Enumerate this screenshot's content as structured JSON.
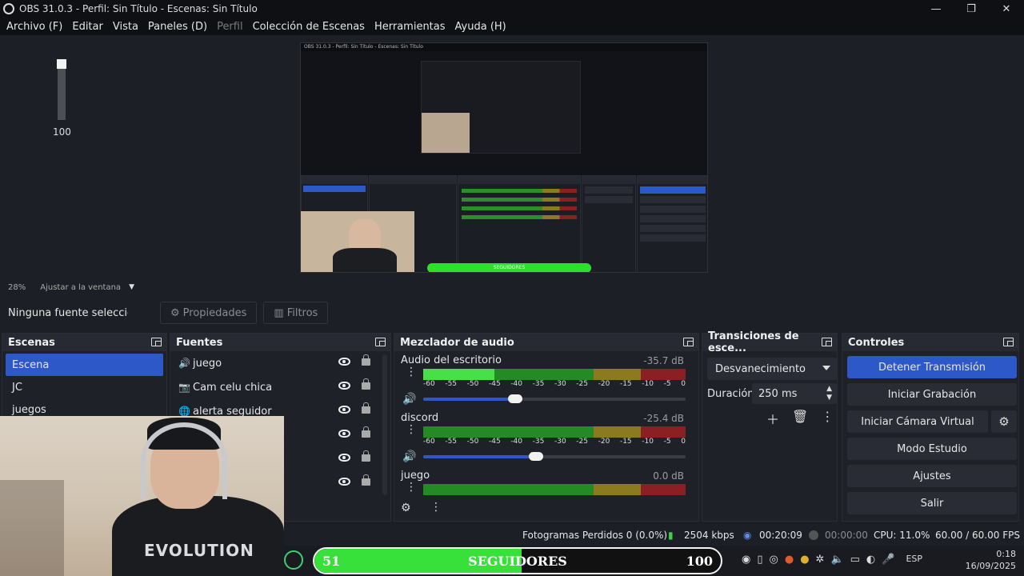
{
  "window": {
    "title": "OBS 31.0.3 - Perfil: Sin Título - Escenas: Sin Título"
  },
  "menu": [
    "Archivo (F)",
    "Editar",
    "Vista",
    "Paneles (D)",
    "Perfil",
    "Colección de Escenas",
    "Herramientas",
    "Ayuda (H)"
  ],
  "preview": {
    "volume_value": "100",
    "nested_title": "OBS 31.0.3 - Perfil: Sin Título - Escenas: Sin Título",
    "nested_follow_label": "SEGUIDORES",
    "zoom": "28%",
    "fit_label": "Ajustar a la ventana"
  },
  "source_toolbar": {
    "no_selection": "Ninguna fuente seleccionada",
    "properties": "Propiedades",
    "filters": "Filtros"
  },
  "scenes": {
    "title": "Escenas",
    "items": [
      "Escena",
      "JC",
      "juegos"
    ],
    "selected": "Escena"
  },
  "sources": {
    "title": "Fuentes",
    "items": [
      {
        "name": "juego",
        "icon": "speaker-icon"
      },
      {
        "name": "Cam celu chica",
        "icon": "camera-icon"
      },
      {
        "name": "alerta seguidor",
        "icon": "browser-icon"
      }
    ]
  },
  "mixer": {
    "title": "Mezclador de audio",
    "ticks": [
      "-60",
      "-55",
      "-50",
      "-45",
      "-40",
      "-35",
      "-30",
      "-25",
      "-20",
      "-15",
      "-10",
      "-5",
      "0"
    ],
    "channels": [
      {
        "name": "Audio del escritorio",
        "db": "-35.7 dB",
        "level": 0.27,
        "volume": 0.35
      },
      {
        "name": "discord",
        "db": "-25.4 dB",
        "level": 0,
        "volume": 0.43
      },
      {
        "name": "juego",
        "db": "0.0 dB",
        "level": 0,
        "volume": 0
      }
    ]
  },
  "transitions": {
    "title": "Transiciones de escena",
    "title_shown": "Transiciones de esce...",
    "current": "Desvanecimiento",
    "duration_label": "Duración",
    "duration": "250 ms"
  },
  "controls": {
    "title": "Controles",
    "buttons": [
      "Detener Transmisión",
      "Iniciar Grabación",
      "Iniciar Cámara Virtual",
      "Modo Estudio",
      "Ajustes",
      "Salir"
    ]
  },
  "status": {
    "dropped": "Fotogramas Perdidos 0 (0.0%)",
    "bitrate": "2504 kbps",
    "stream_time": "00:20:09",
    "rec_time": "00:00:00",
    "cpu": "CPU: 11.0%",
    "fps": "60.00 / 60.00 FPS"
  },
  "overlay": {
    "shirt_logo": "EVOLUTION",
    "followers_current": "51",
    "followers_label": "SEGUIDORES",
    "followers_goal": "100",
    "followers_fraction": 0.51
  },
  "taskbar": {
    "lang": "ESP",
    "time": "0:18",
    "date": "16/09/2025"
  },
  "colors": {
    "accent": "#2d58c7",
    "meter_green": "#258a25",
    "follow_green": "#38e03a"
  }
}
